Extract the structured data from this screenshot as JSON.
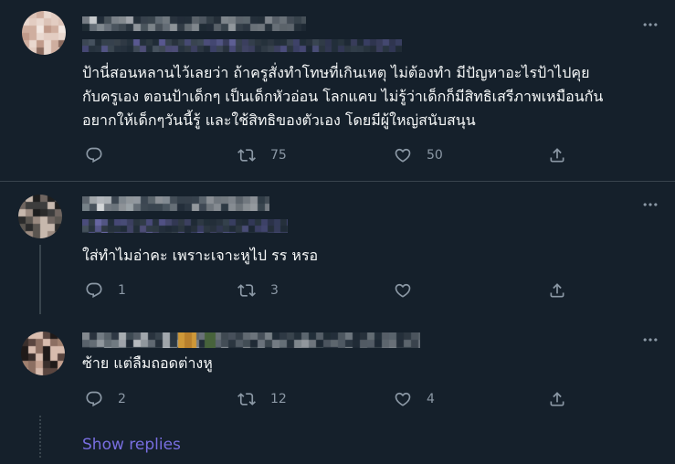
{
  "theme": {
    "background": "#15202b",
    "text": "#f7f9f9",
    "muted": "#8b98a5",
    "divider": "#38444d",
    "accent": "#786ee0"
  },
  "icons": {
    "reply": "reply-icon",
    "retweet": "retweet-icon",
    "like": "heart-icon",
    "share": "share-icon",
    "more": "more-icon"
  },
  "tweets": [
    {
      "body_lines": [
        "ป้านี่สอนหลานไว้เลยว่า ถ้าครูสั่งทำโทษที่เกินเหตุ ไม่ต้องทำ มีปัญหาอะไรป้าไปคุย",
        "กับครูเอง ตอนป้าเด็กๆ เป็นเด็กหัวอ่อน โลกแคบ ไม่รู้ว่าเด็กก็มีสิทธิเสรีภาพเหมือนกัน",
        "อยากให้เด็กๆวันนี้รู้ และใช้สิทธิของตัวเอง โดยมีผู้ใหญ่สนับสนุน"
      ],
      "retweets": "75",
      "likes": "50"
    },
    {
      "body_lines": [
        "ใส่ทำไมอ่าคะ เพราะเจาะหูไป รร หรอ"
      ],
      "replies": "1",
      "retweets": "3"
    },
    {
      "body_lines": [
        "ซ้าย แต่ลืมถอดต่างหู"
      ],
      "replies": "2",
      "retweets": "12",
      "likes": "4"
    }
  ],
  "show_replies_label": "Show replies"
}
